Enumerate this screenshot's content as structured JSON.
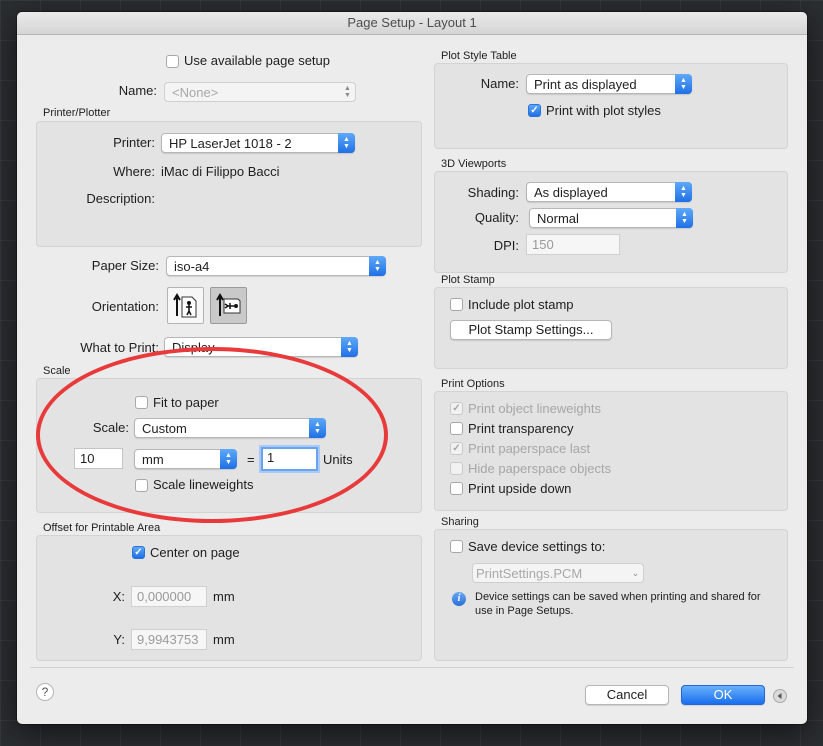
{
  "window": {
    "title": "Page Setup - Layout 1"
  },
  "page_setup": {
    "use_available_label": "Use available page setup",
    "use_available_checked": false,
    "name_label": "Name:",
    "name_value": "<None>"
  },
  "printer": {
    "section_title": "Printer/Plotter",
    "printer_label": "Printer:",
    "printer_value": "HP LaserJet 1018 - 2",
    "where_label": "Where:",
    "where_value": "iMac di Filippo Bacci",
    "description_label": "Description:"
  },
  "paper": {
    "paper_size_label": "Paper Size:",
    "paper_size_value": "iso-a4",
    "orientation_label": "Orientation:",
    "portrait_icon": "portrait-orientation-icon",
    "landscape_icon": "landscape-orientation-icon",
    "what_to_print_label": "What to Print:",
    "what_to_print_value": "Display"
  },
  "scale": {
    "section_title": "Scale",
    "fit_to_paper_label": "Fit to paper",
    "fit_to_paper_checked": false,
    "scale_label": "Scale:",
    "scale_value": "Custom",
    "paper_value": "10",
    "unit_value": "mm",
    "equals": "=",
    "drawing_units_value": "1",
    "units_label": "Units",
    "lineweights_label": "Scale lineweights",
    "lineweights_checked": false
  },
  "offset": {
    "section_title": "Offset for Printable Area",
    "center_label": "Center on page",
    "center_checked": true,
    "x_label": "X:",
    "x_value": "0,000000",
    "x_unit": "mm",
    "y_label": "Y:",
    "y_value": "9,9943753",
    "y_unit": "mm"
  },
  "plot_style": {
    "section_title": "Plot Style Table",
    "name_label": "Name:",
    "name_value": "Print as displayed",
    "print_with_styles_label": "Print with plot styles",
    "print_with_styles_checked": true
  },
  "viewports": {
    "section_title": "3D Viewports",
    "shading_label": "Shading:",
    "shading_value": "As displayed",
    "quality_label": "Quality:",
    "quality_value": "Normal",
    "dpi_label": "DPI:",
    "dpi_value": "150"
  },
  "plot_stamp": {
    "section_title": "Plot Stamp",
    "include_label": "Include plot stamp",
    "include_checked": false,
    "settings_button": "Plot Stamp Settings..."
  },
  "print_options": {
    "section_title": "Print Options",
    "items": [
      {
        "label": "Print object lineweights",
        "checked": true,
        "enabled": false
      },
      {
        "label": "Print transparency",
        "checked": false,
        "enabled": true
      },
      {
        "label": "Print paperspace last",
        "checked": true,
        "enabled": false
      },
      {
        "label": "Hide paperspace objects",
        "checked": false,
        "enabled": false
      },
      {
        "label": "Print upside down",
        "checked": false,
        "enabled": true
      }
    ]
  },
  "sharing": {
    "section_title": "Sharing",
    "save_label": "Save device settings to:",
    "save_checked": false,
    "file_value": "PrintSettings.PCM",
    "info_icon": "info-icon",
    "info_text": "Device settings can be saved when printing and shared for use in Page Setups."
  },
  "footer": {
    "help_label": "?",
    "cancel_label": "Cancel",
    "ok_label": "OK",
    "expand_icon": "disclosure-arrow-icon"
  },
  "annotation": {
    "color": "#e8393b"
  },
  "colors": {
    "accent": "#1f70e6",
    "dialog_bg": "#ececec"
  }
}
